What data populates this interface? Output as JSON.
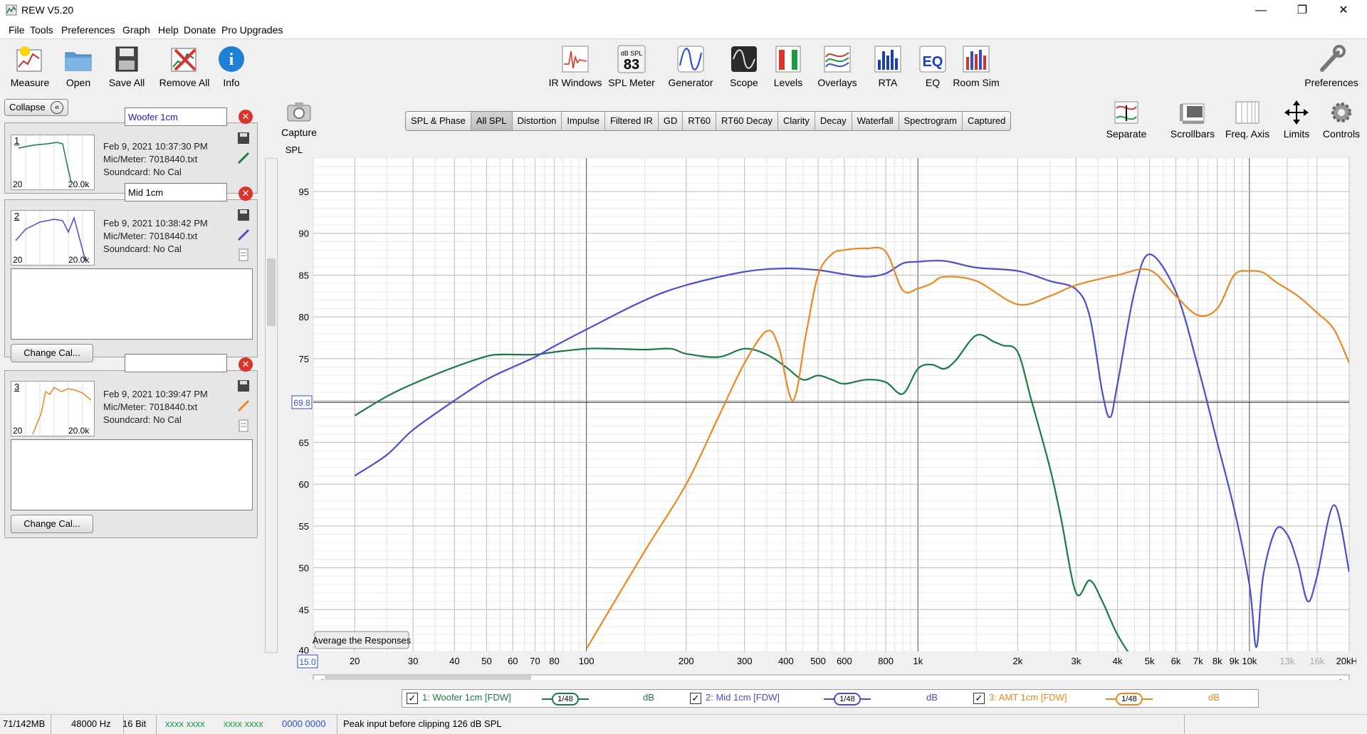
{
  "window": {
    "title": "REW V5.20",
    "minimize": "—",
    "restore": "❐",
    "close": "✕"
  },
  "menu": [
    "File",
    "Tools",
    "Preferences",
    "Graph",
    "Help",
    "Donate",
    "Pro Upgrades"
  ],
  "toolbar": {
    "left": [
      {
        "label": "Measure",
        "icon": "measure-icon"
      },
      {
        "label": "Open",
        "icon": "folder-icon"
      },
      {
        "label": "Save All",
        "icon": "floppy-icon"
      },
      {
        "label": "Remove All",
        "icon": "remove-icon"
      },
      {
        "label": "Info",
        "icon": "info-icon"
      }
    ],
    "center": [
      {
        "label": "IR Windows",
        "icon": "ir-windows-icon"
      },
      {
        "label": "SPL Meter",
        "icon": "spl-meter-icon",
        "badge_top": "dB SPL",
        "badge_value": "83"
      },
      {
        "label": "Generator",
        "icon": "generator-icon"
      },
      {
        "label": "Scope",
        "icon": "scope-icon"
      },
      {
        "label": "Levels",
        "icon": "levels-icon"
      },
      {
        "label": "Overlays",
        "icon": "overlays-icon"
      },
      {
        "label": "RTA",
        "icon": "rta-icon"
      },
      {
        "label": "EQ",
        "icon": "eq-icon",
        "badge_value": "EQ"
      },
      {
        "label": "Room Sim",
        "icon": "room-sim-icon"
      }
    ],
    "preferences": {
      "label": "Preferences",
      "icon": "wrench-icon"
    }
  },
  "left_panel": {
    "collapse_label": "Collapse",
    "collapse_glyph": "«",
    "measurements": [
      {
        "index": "1",
        "name": "Woofer 1cm",
        "name_color": "#1a1ab8",
        "date": "Feb 9, 2021 10:37:30 PM",
        "mic": "Mic/Meter: 7018440.txt",
        "soundcard": "Soundcard: No Cal",
        "thumb_min": "20",
        "thumb_max": "20.0k",
        "color": "#1a7a45"
      },
      {
        "index": "2",
        "name": "Mid 1cm",
        "name_color": "#1a1ab8",
        "date": "Feb 9, 2021 10:38:42 PM",
        "mic": "Mic/Meter: 7018440.txt",
        "soundcard": "Soundcard: No Cal",
        "thumb_min": "20",
        "thumb_max": "20.0k",
        "color": "#4b4bd6",
        "change_cal": "Change Cal..."
      },
      {
        "index": "3",
        "name": "AMT 1cm",
        "name_color": "#ffffff",
        "date": "Feb 9, 2021 10:39:47 PM",
        "mic": "Mic/Meter: 7018440.txt",
        "soundcard": "Soundcard: No Cal",
        "thumb_min": "20",
        "thumb_max": "20.0k",
        "color": "#f0861e",
        "change_cal": "Change Cal..."
      }
    ]
  },
  "capture": {
    "label": "Capture",
    "icon": "camera-icon"
  },
  "graph_tabs": [
    "SPL & Phase",
    "All SPL",
    "Distortion",
    "Impulse",
    "Filtered IR",
    "GD",
    "RT60",
    "RT60 Decay",
    "Clarity",
    "Decay",
    "Waterfall",
    "Spectrogram",
    "Captured"
  ],
  "active_tab": "All SPL",
  "graph_controls": [
    {
      "label": "Separate",
      "icon": "separate-icon"
    },
    {
      "label": "Scrollbars",
      "icon": "scrollbars-icon"
    },
    {
      "label": "Freq. Axis",
      "icon": "freq-axis-icon"
    },
    {
      "label": "Limits",
      "icon": "limits-icon"
    },
    {
      "label": "Controls",
      "icon": "gear-icon"
    }
  ],
  "average_button": "Average the Responses",
  "chart_data": {
    "type": "line",
    "ylabel": "SPL",
    "xscale": "log",
    "xlim": [
      15,
      20000
    ],
    "ylim": [
      40,
      99
    ],
    "cursor_value": "69.8",
    "x_left_label": "15.0",
    "y_ticks": [
      45,
      50,
      55,
      60,
      65,
      70,
      75,
      80,
      85,
      90,
      95
    ],
    "y_tick_labels": [
      "45",
      "50",
      "55",
      "60",
      "65",
      "",
      "75",
      "80",
      "85",
      "90",
      "95"
    ],
    "y_bottom_label": "40",
    "x_ticks": [
      {
        "v": 20,
        "label": "20"
      },
      {
        "v": 30,
        "label": "30"
      },
      {
        "v": 40,
        "label": "40"
      },
      {
        "v": 50,
        "label": "50"
      },
      {
        "v": 60,
        "label": "60"
      },
      {
        "v": 70,
        "label": "70"
      },
      {
        "v": 80,
        "label": "80"
      },
      {
        "v": 100,
        "label": "100"
      },
      {
        "v": 200,
        "label": "200"
      },
      {
        "v": 300,
        "label": "300"
      },
      {
        "v": 400,
        "label": "400"
      },
      {
        "v": 500,
        "label": "500"
      },
      {
        "v": 600,
        "label": "600"
      },
      {
        "v": 800,
        "label": "800"
      },
      {
        "v": 1000,
        "label": "1k"
      },
      {
        "v": 2000,
        "label": "2k"
      },
      {
        "v": 3000,
        "label": "3k"
      },
      {
        "v": 4000,
        "label": "4k"
      },
      {
        "v": 5000,
        "label": "5k"
      },
      {
        "v": 6000,
        "label": "6k"
      },
      {
        "v": 7000,
        "label": "7k"
      },
      {
        "v": 8000,
        "label": "8k"
      },
      {
        "v": 9000,
        "label": "9k"
      },
      {
        "v": 10000,
        "label": "10k"
      },
      {
        "v": 13000,
        "label": "13k",
        "faded": true
      },
      {
        "v": 16000,
        "label": "16k",
        "faded": true
      },
      {
        "v": 20000,
        "label": "20kHz"
      }
    ],
    "series": [
      {
        "name": "1: Woofer 1cm [FDW]",
        "color": "#1a7a45",
        "x": [
          20,
          25,
          30,
          40,
          50,
          55,
          60,
          70,
          80,
          100,
          120,
          150,
          180,
          200,
          250,
          300,
          350,
          400,
          450,
          500,
          550,
          600,
          700,
          800,
          900,
          1000,
          1100,
          1200,
          1300,
          1500,
          1700,
          1800,
          2000,
          2200,
          2500,
          2700,
          3000,
          3300,
          3600,
          4000,
          4500,
          5000
        ],
        "y": [
          68.2,
          70.5,
          72.0,
          74.0,
          75.3,
          75.5,
          75.5,
          75.5,
          75.8,
          76.2,
          76.2,
          76.1,
          76.2,
          75.6,
          75.2,
          76.2,
          75.5,
          74.0,
          72.5,
          73.0,
          72.5,
          72.0,
          72.5,
          72.2,
          70.8,
          73.8,
          74.3,
          73.8,
          74.8,
          77.8,
          77.0,
          76.6,
          75.8,
          70.0,
          62.0,
          56.0,
          47.0,
          48.5,
          46.0,
          42.0,
          39.0,
          38.0
        ]
      },
      {
        "name": "2: Mid 1cm [FDW]",
        "color": "#4b4bd6",
        "x": [
          20,
          25,
          30,
          40,
          50,
          60,
          70,
          80,
          100,
          150,
          200,
          300,
          400,
          500,
          600,
          700,
          800,
          900,
          1000,
          1200,
          1500,
          2000,
          2500,
          3000,
          3300,
          3600,
          3800,
          4000,
          4500,
          5000,
          6000,
          7000,
          8000,
          9000,
          10000,
          10500,
          11000,
          12000,
          13000,
          14000,
          15000,
          16000,
          18000,
          20000
        ],
        "y": [
          61.0,
          63.5,
          66.5,
          70.0,
          72.5,
          74.0,
          75.2,
          76.5,
          78.5,
          82.0,
          83.8,
          85.4,
          85.8,
          85.6,
          85.1,
          84.8,
          85.2,
          86.4,
          86.6,
          86.7,
          85.9,
          85.5,
          84.3,
          83.3,
          80.0,
          71.0,
          68.0,
          72.0,
          83.0,
          87.5,
          83.0,
          74.0,
          65.0,
          57.0,
          48.0,
          40.5,
          49.0,
          54.5,
          54.0,
          50.5,
          46.0,
          49.0,
          57.5,
          49.5
        ]
      },
      {
        "name": "3: AMT 1cm [FDW]",
        "color": "#f0861e",
        "x": [
          100,
          150,
          200,
          250,
          300,
          350,
          380,
          420,
          460,
          500,
          550,
          600,
          700,
          800,
          900,
          1000,
          1100,
          1200,
          1500,
          2000,
          2500,
          3000,
          4000,
          5000,
          6000,
          7000,
          8000,
          9000,
          10000,
          11000,
          12000,
          14000,
          16000,
          18000,
          20000
        ],
        "y": [
          40.3,
          52.0,
          60.0,
          68.0,
          74.5,
          78.3,
          76.5,
          70.0,
          78.0,
          85.0,
          87.5,
          88.0,
          88.2,
          87.8,
          83.2,
          83.4,
          84.0,
          84.8,
          84.3,
          81.5,
          82.5,
          83.8,
          85.0,
          85.6,
          82.5,
          80.2,
          81.0,
          85.0,
          85.5,
          85.3,
          84.2,
          82.5,
          80.5,
          78.5,
          74.5
        ]
      }
    ]
  },
  "legend": {
    "items": [
      {
        "label": "1: Woofer 1cm [FDW]",
        "smoothing": "1/48",
        "unit": "dB",
        "color": "#1a7a45"
      },
      {
        "label": "2: Mid 1cm [FDW]",
        "smoothing": "1/48",
        "unit": "dB",
        "color": "#4b4bd6"
      },
      {
        "label": "3: AMT 1cm [FDW]",
        "smoothing": "1/48",
        "unit": "dB",
        "color": "#f0861e"
      }
    ]
  },
  "status": {
    "memory": "71/142MB",
    "rate": "48000 Hz",
    "bits": "16 Bit",
    "meter1": "xxxx xxxx",
    "meter2": "xxxx xxxx",
    "meter3": "0000 0000",
    "message": "Peak input before clipping 126 dB SPL"
  }
}
